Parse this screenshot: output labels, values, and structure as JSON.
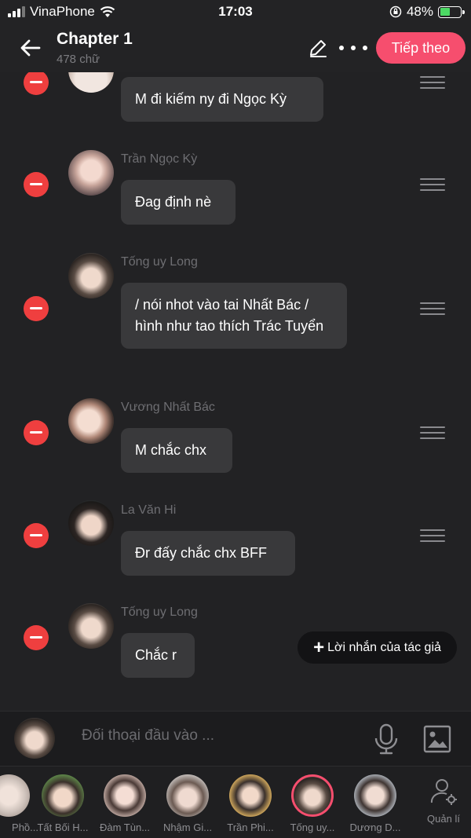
{
  "status": {
    "carrier": "VinaPhone",
    "time": "17:03",
    "battery": "48%"
  },
  "header": {
    "title": "Chapter 1",
    "word_count": "478 chữ",
    "next_label": "Tiếp theo"
  },
  "messages": [
    {
      "author": "",
      "text": "M đi kiếm ny đi Ngọc Kỳ"
    },
    {
      "author": "Trần Ngọc Kỳ",
      "text": "Đag định nè"
    },
    {
      "author": "Tống uy Long",
      "text": "/ nói nhot vào tai Nhất Bác / hình như tao thích Trác Tuyển"
    },
    {
      "author": "Vương Nhất Bác",
      "text": "M chắc chx"
    },
    {
      "author": "La Văn Hi",
      "text": "Đr đấy chắc chx BFF"
    },
    {
      "author": "Tống uy Long",
      "text": "Chắc r"
    }
  ],
  "author_note": {
    "label": "Lời nhắn của tác giả"
  },
  "input": {
    "placeholder": "Đối thoại đầu vào ..."
  },
  "characters": [
    {
      "name": "Phồ..."
    },
    {
      "name": "Tất Bối H..."
    },
    {
      "name": "Đàm Tùn..."
    },
    {
      "name": "Nhậm Gi..."
    },
    {
      "name": "Trần Phi..."
    },
    {
      "name": "Tống uy..."
    },
    {
      "name": "Dương D..."
    }
  ],
  "manage": {
    "label": "Quản lí"
  },
  "colors": {
    "accent": "#f64e6e",
    "delete": "#ef3f3f",
    "bubble": "#39393b",
    "background": "#222224"
  },
  "icons": [
    "back-arrow-icon",
    "pencil-icon",
    "more-icon",
    "minus-icon",
    "drag-handle-icon",
    "plus-icon",
    "microphone-icon",
    "image-icon",
    "user-gear-icon",
    "wifi-icon",
    "signal-icon",
    "battery-icon",
    "rotation-lock-icon"
  ]
}
